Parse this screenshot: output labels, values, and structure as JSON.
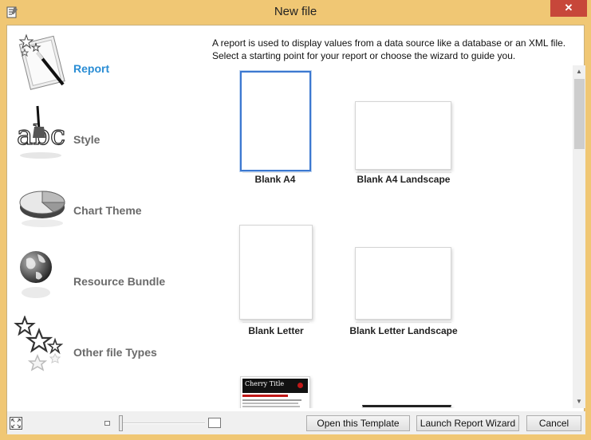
{
  "window": {
    "title": "New file",
    "close_glyph": "✕"
  },
  "categories": [
    {
      "label": "Report",
      "icon": "report-wand-icon",
      "active": true
    },
    {
      "label": "Style",
      "icon": "style-abc-brush-icon",
      "active": false
    },
    {
      "label": "Chart Theme",
      "icon": "pie-chart-icon",
      "active": false
    },
    {
      "label": "Resource Bundle",
      "icon": "globe-icon",
      "active": false
    },
    {
      "label": "Other file Types",
      "icon": "stars-icon",
      "active": false
    }
  ],
  "description": {
    "line1": "A report is used to display values from a data source like a database or an XML file.",
    "line2": "Select a starting point for your report or choose the wizard to guide you."
  },
  "templates": [
    {
      "label": "Blank A4",
      "selected": true
    },
    {
      "label": "Blank A4 Landscape",
      "selected": false
    },
    {
      "label": "Blank Letter",
      "selected": false
    },
    {
      "label": "Blank Letter Landscape",
      "selected": false
    },
    {
      "label": "Cherry Title",
      "selected": false
    },
    {
      "label": "",
      "selected": false
    }
  ],
  "footer": {
    "open_template": "Open this Template",
    "launch_wizard": "Launch Report Wizard",
    "cancel": "Cancel"
  },
  "colors": {
    "active_category": "#2a8dd4",
    "selection": "#3c78d0",
    "frame": "#f0c774",
    "close": "#c7473a"
  }
}
